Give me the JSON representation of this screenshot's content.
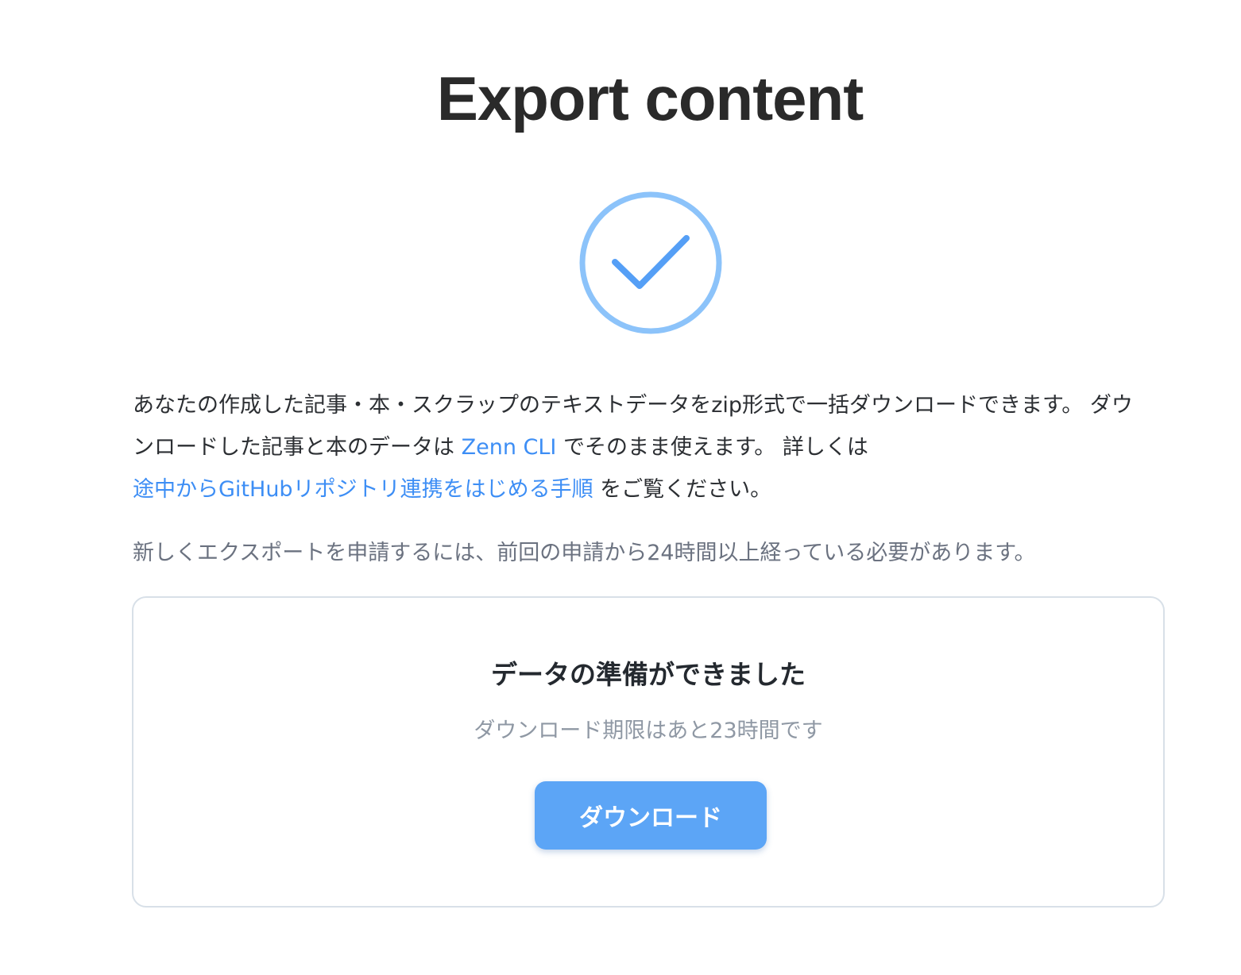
{
  "page": {
    "title": "Export content"
  },
  "icons": {
    "success": "check-circle-icon"
  },
  "intro": {
    "text_1": "あなたの作成した記事・本・スクラップのテキストデータをzip形式で一括ダウンロードできます。 ダウンロードした記事と本のデータは ",
    "link_cli": "Zenn CLI",
    "text_2": " でそのまま使えます。 詳しくは",
    "link_guide": "途中からGitHubリポジトリ連携をはじめる手順",
    "text_3": " をご覧ください。"
  },
  "notice": {
    "text": "新しくエクスポートを申請するには、前回の申請から24時間以上経っている必要があります。"
  },
  "card": {
    "title": "データの準備ができました",
    "subtitle": "ダウンロード期限はあと23時間です",
    "button_label": "ダウンロード"
  },
  "colors": {
    "accent": "#5ca5f6",
    "link": "#3d8ef5",
    "icon_ring": "#8cc3fa",
    "icon_check": "#559ff6",
    "muted_text": "#8f98a4",
    "card_border": "#d8e0e8"
  }
}
